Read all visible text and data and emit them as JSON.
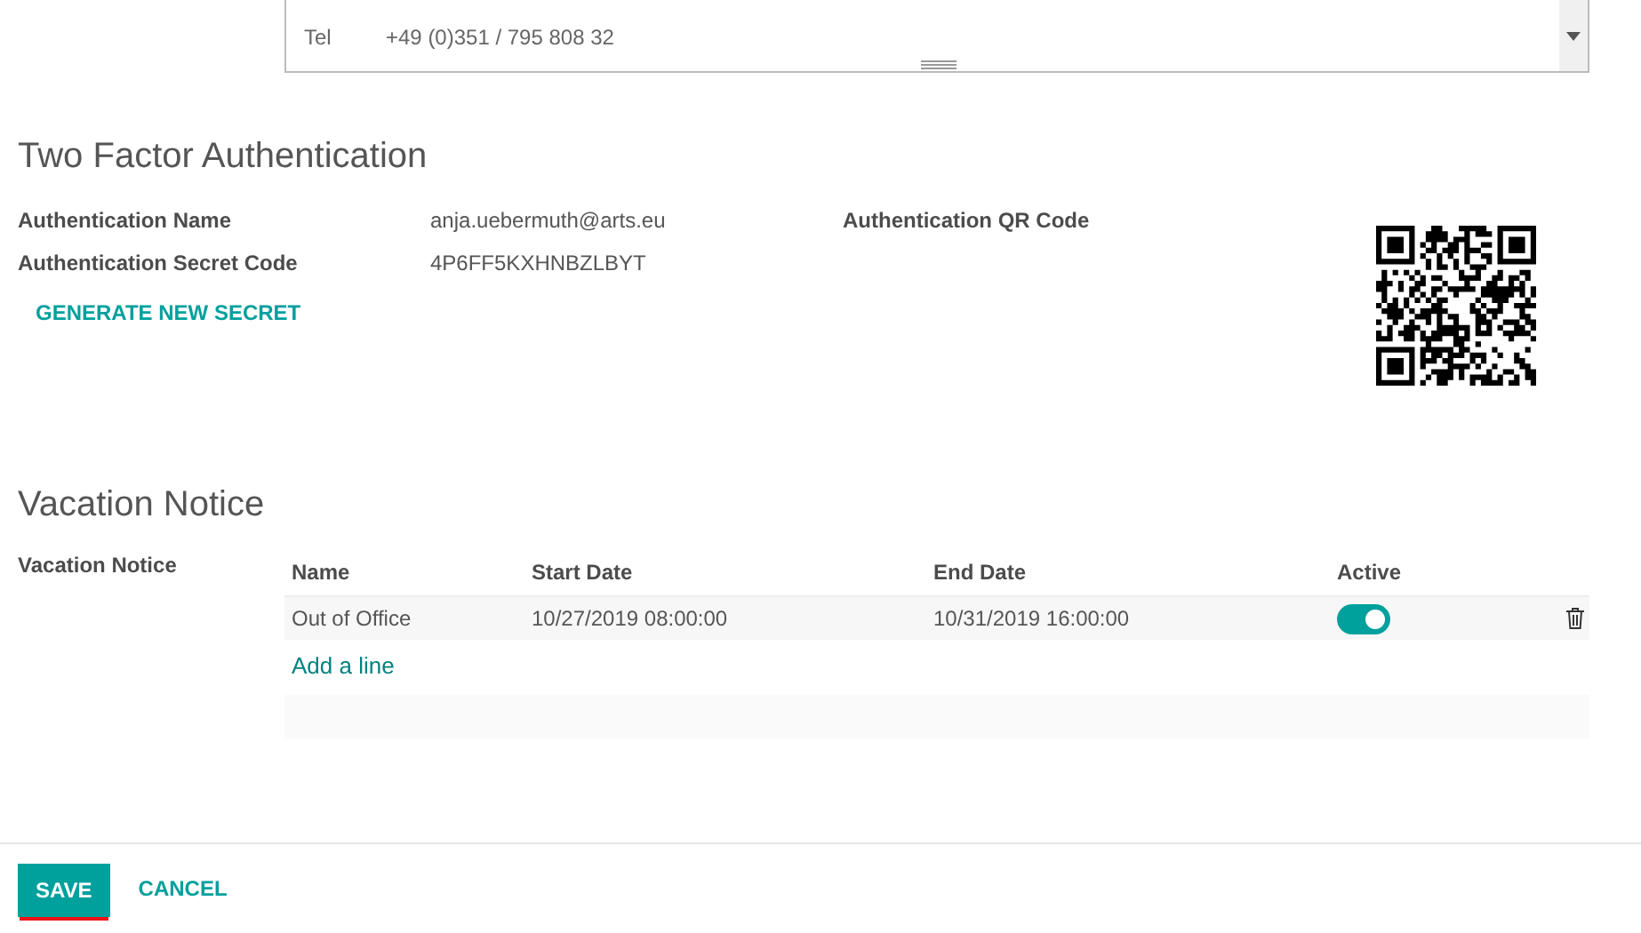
{
  "address_box": {
    "lines": [
      {
        "label": "Tel",
        "value": "+49 (0)351 / 795 808 32"
      }
    ]
  },
  "two_factor": {
    "title": "Two Factor Authentication",
    "fields": [
      {
        "label": "Authentication Name",
        "value": "anja.uebermuth@arts.eu"
      },
      {
        "label": "Authentication Secret Code",
        "value": "4P6FF5KXHNBZLBYT"
      }
    ],
    "generate_button": "GENERATE NEW SECRET",
    "qr_label": "Authentication QR Code"
  },
  "vacation": {
    "title": "Vacation Notice",
    "field_label": "Vacation Notice",
    "columns": [
      "Name",
      "Start Date",
      "End Date",
      "Active"
    ],
    "rows": [
      {
        "name": "Out of Office",
        "start": "10/27/2019 08:00:00",
        "end": "10/31/2019 16:00:00",
        "active": true
      }
    ],
    "add_line": "Add a line"
  },
  "footer": {
    "save": "SAVE",
    "cancel": "CANCEL"
  }
}
